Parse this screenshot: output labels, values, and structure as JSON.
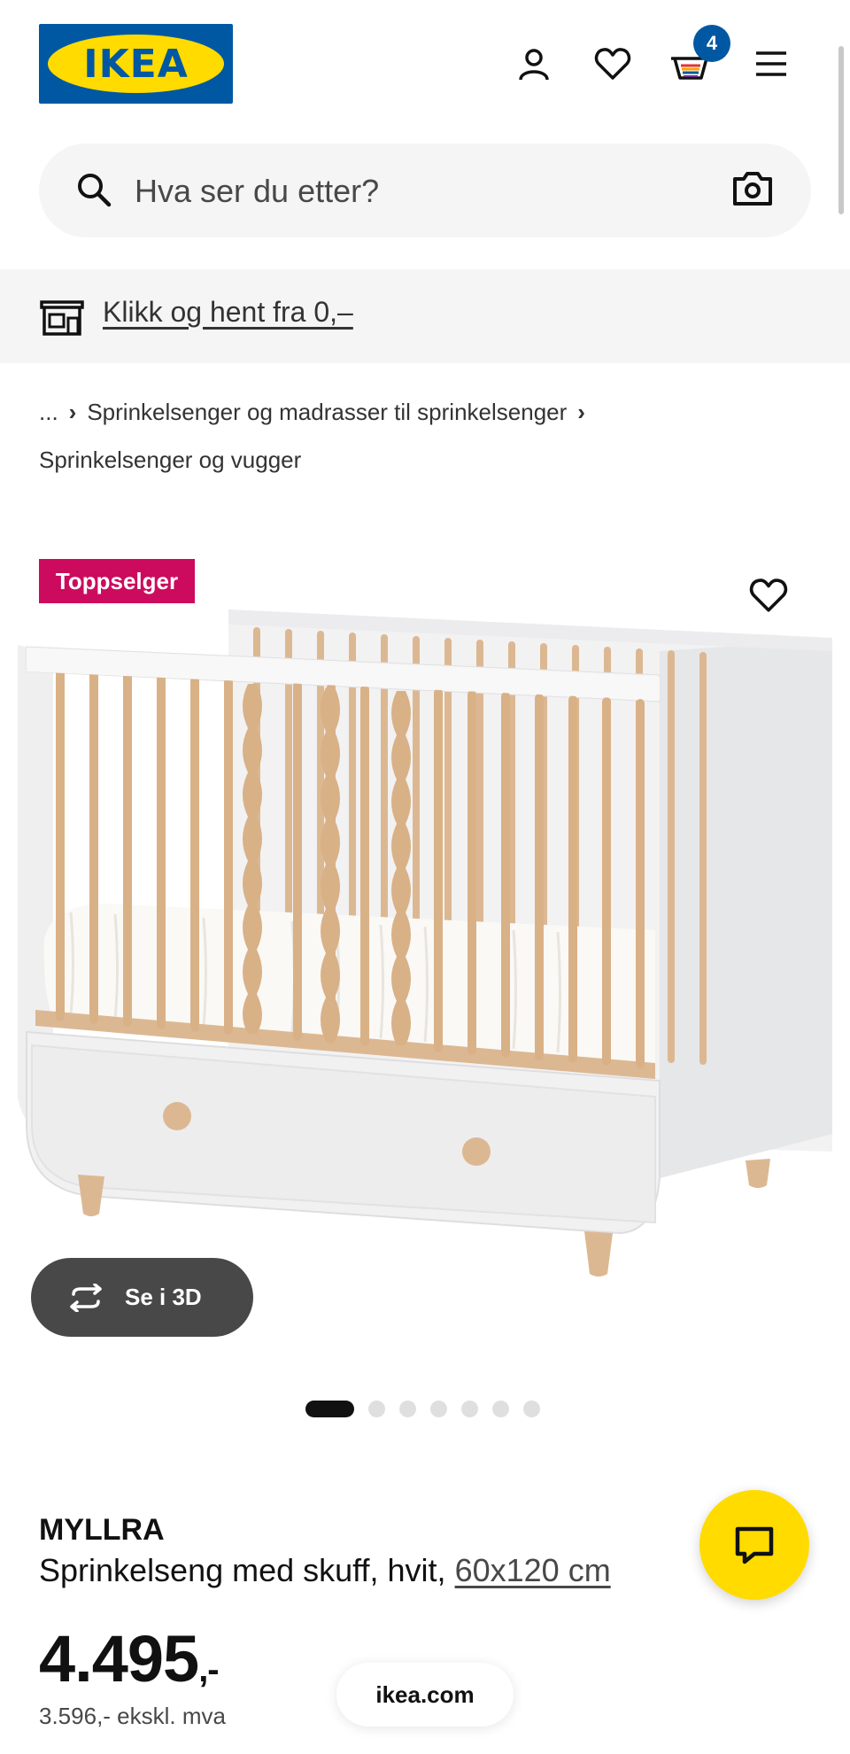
{
  "header": {
    "logo_text": "IKEA",
    "logo_reg": "®",
    "icons": [
      "account-icon",
      "heart-icon",
      "cart-icon",
      "menu-icon"
    ],
    "cart_count": "4"
  },
  "search": {
    "placeholder": "Hva ser du etter?"
  },
  "promo": {
    "link_text": "Klikk og hent fra 0,–"
  },
  "breadcrumb": {
    "ellipsis": "...",
    "separator": "›",
    "level1": "Sprinkelsenger og madrasser til sprinkelsenger",
    "level2": "Sprinkelsenger og vugger"
  },
  "product": {
    "badge": "Toppselger",
    "view_3d_label": "Se i 3D",
    "gallery_images": 7,
    "gallery_active_index": 0,
    "name": "MYLLRA",
    "description": "Sprinkelseng med skuff, hvit,",
    "size_link": "60x120 cm",
    "price_main": "4.495",
    "price_decimal": ",-",
    "price_ex_vat": "3.596,- ekskl. mva"
  },
  "footer": {
    "domain": "ikea.com"
  },
  "colors": {
    "ikea_blue": "#0058a3",
    "ikea_yellow": "#ffdb00",
    "badge_pink": "#cc0b5e",
    "button_dark": "#484848"
  }
}
